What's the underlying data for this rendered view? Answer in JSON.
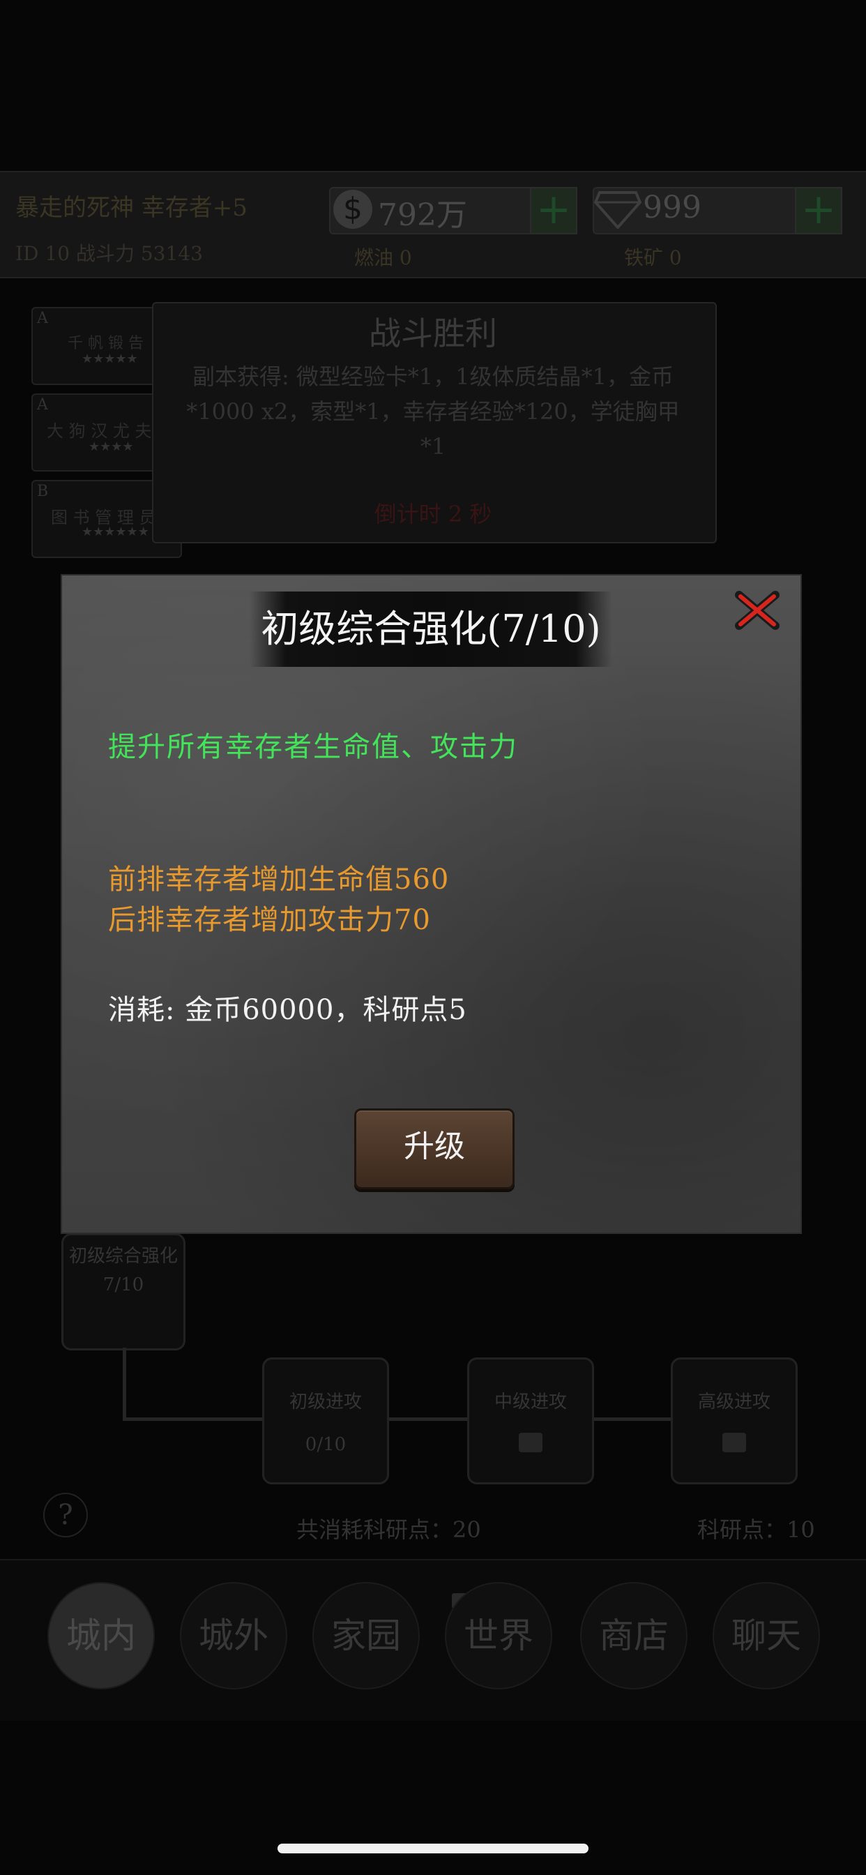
{
  "background": {
    "player_name": "暴走的死神  幸存者+5",
    "player_id": "ID 10  战斗力 53143",
    "gold": "792万",
    "gems": "999",
    "fuel_label": "燃油  0",
    "ore_label": "铁矿  0",
    "battle": {
      "title": "战斗胜利",
      "rewards": "副本获得: 微型经验卡*1，1级体质结晶*1，金币*1000 x2，索型*1，幸存者经验*120，学徒胸甲*1",
      "countdown": "倒计时 2 秒"
    },
    "team": [
      {
        "grade": "A",
        "name": "千 帆 锻 告",
        "stars": "★★★★★"
      },
      {
        "grade": "A",
        "name": "大 狗 汉 尤 夫",
        "stars": "★★★★"
      },
      {
        "grade": "B",
        "name": "图 书 管 理 员",
        "stars": "★★★★★★"
      }
    ],
    "research_tree": {
      "root": {
        "name": "初级综合强化",
        "progress": "7/10"
      },
      "nodes": [
        {
          "name": "初级进攻",
          "progress": "0/10"
        },
        {
          "name": "中级进攻",
          "progress": ""
        },
        {
          "name": "高级进攻",
          "progress": ""
        }
      ],
      "total_cost": "共消耗科研点：20",
      "points": "科研点：10"
    },
    "help": "?",
    "nav": [
      "城内",
      "城外",
      "家园",
      "世界",
      "商店",
      "聊天"
    ]
  },
  "modal": {
    "title": "初级综合强化(7/10)",
    "description": "提升所有幸存者生命值、攻击力",
    "effects": [
      "前排幸存者增加生命值560",
      "后排幸存者增加攻击力70"
    ],
    "cost": "消耗: 金币60000，科研点5",
    "upgrade_label": "升级"
  },
  "colors": {
    "description": "#43e45a",
    "effects": "#e89a2e",
    "close": "#d8261f",
    "button": "#4a3526"
  }
}
